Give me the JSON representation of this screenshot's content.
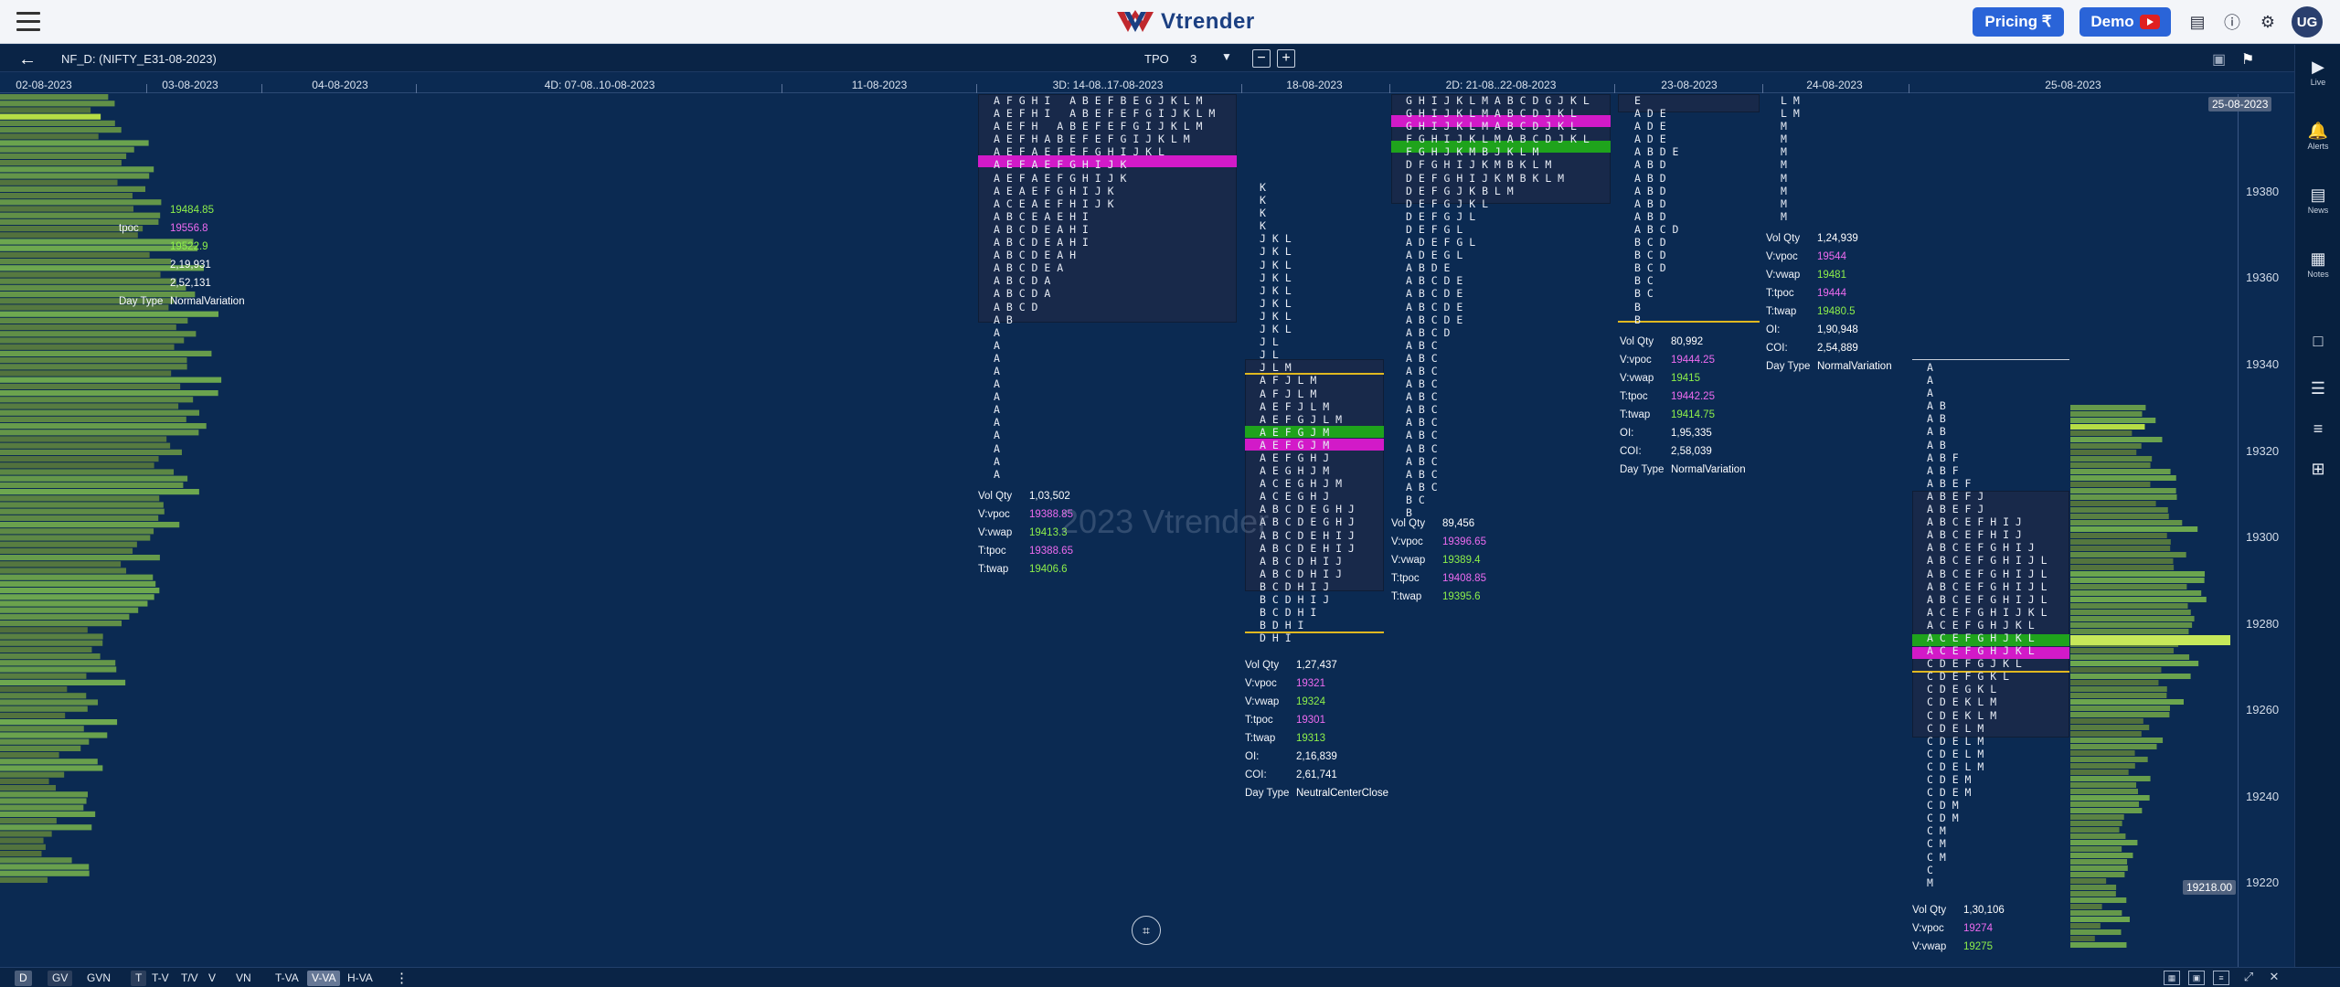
{
  "header": {
    "brand": "Vtrender",
    "pricing_label": "Pricing ₹",
    "demo_label": "Demo",
    "avatar_initials": "UG"
  },
  "toolbar": {
    "symbol": "NF_D: (NIFTY_E31-08-2023)",
    "tpo_label": "TPO",
    "tpo_value": "3",
    "dropdown_glyph": "▼",
    "minus": "−",
    "plus": "+"
  },
  "dates": [
    "02-08-2023",
    "03-08-2023",
    "04-08-2023",
    "4D: 07-08..10-08-2023",
    "11-08-2023",
    "3D: 14-08..17-08-2023",
    "18-08-2023",
    "2D: 21-08..22-08-2023",
    "23-08-2023",
    "24-08-2023",
    "25-08-2023"
  ],
  "price_axis": [
    "19380",
    "19360",
    "19340",
    "19320",
    "19300",
    "19280",
    "19260",
    "19240",
    "19220"
  ],
  "price_tags": {
    "top": "25-08-2023",
    "current": "19218.00"
  },
  "watermark": "2023 Vtrender",
  "profiles": [
    {
      "id": "d0308",
      "stats": [
        {
          "k": "",
          "v": "19484.85",
          "c": "green"
        },
        {
          "k": "tpoc",
          "v": "19556.8",
          "c": "pink"
        },
        {
          "k": "",
          "v": "19522.9",
          "c": "green"
        },
        {
          "k": "",
          "v": "2,19,931",
          "c": "white"
        },
        {
          "k": "",
          "v": "2,52,131",
          "c": "white"
        },
        {
          "k": "Day Type",
          "v": "NormalVariation",
          "c": "white"
        }
      ]
    },
    {
      "id": "d3d1417",
      "letters": [
        "AFGHI ABEFBEGJKLM",
        "AEFHI ABEFEFGIJKLM",
        "AEFH ABEFEFGIJKLM",
        "AEFHABEFEFGIJKLM",
        "AEFAEFEFGHIJKL",
        "AEFAEFGHIJK",
        "AEFAEFGHIJK",
        "AEAEFGHIJK",
        "ACEAEFHIJK",
        "ABCEAEHI",
        "ABCDEAHI",
        "ABCDEAHI",
        "ABCDEAH",
        "ABCDEA",
        "ABCDA",
        "ABCDA",
        "ABCD",
        "AB",
        "A",
        "A",
        "A",
        "A",
        "A",
        "A",
        "A",
        "A",
        "A",
        "A",
        "A",
        "A"
      ],
      "stats": [
        {
          "k": "Vol Qty",
          "v": "1,03,502",
          "c": "white"
        },
        {
          "k": "V:vpoc",
          "v": "19388.85",
          "c": "pink"
        },
        {
          "k": "V:vwap",
          "v": "19413.3",
          "c": "green"
        },
        {
          "k": "T:tpoc",
          "v": "19388.65",
          "c": "pink"
        },
        {
          "k": "T:twap",
          "v": "19406.6",
          "c": "green"
        }
      ]
    },
    {
      "id": "d1808",
      "letters": [
        "K",
        "K",
        "K",
        "K",
        "JKL",
        "JKL",
        "JKL",
        "JKL",
        "JKL",
        "JKL",
        "JKL",
        "JKL",
        "JL",
        "JL",
        "JLM",
        "AFJLM",
        "AFJLM",
        "AEFJLM",
        "AEFGJLM",
        "AEFGJM",
        "AEFGJM",
        "AEFGHJ",
        "AEGHJM",
        "ACEGHJM",
        "ACEGHJ",
        "ABCDEGHJ",
        "ABCDEGHJ",
        "ABCDEHIJ",
        "ABCDEHIJ",
        "ABCDHIJ",
        "ABCDHIJ",
        "BCDHIJ",
        "BCDHIJ",
        "BCDHI",
        "BDHI",
        "DHI"
      ],
      "stats": [
        {
          "k": "Vol Qty",
          "v": "1,27,437",
          "c": "white"
        },
        {
          "k": "V:vpoc",
          "v": "19321",
          "c": "pink"
        },
        {
          "k": "V:vwap",
          "v": "19324",
          "c": "green"
        },
        {
          "k": "T:tpoc",
          "v": "19301",
          "c": "pink"
        },
        {
          "k": "T:twap",
          "v": "19313",
          "c": "green"
        },
        {
          "k": "OI:",
          "v": "2,16,839",
          "c": "white"
        },
        {
          "k": "COI:",
          "v": "2,61,741",
          "c": "white"
        },
        {
          "k": "Day Type",
          "v": "NeutralCenterClose",
          "c": "white"
        }
      ]
    },
    {
      "id": "d2d2122",
      "letters": [
        "GHIJKLMABCDGJKL",
        "GHIJKLMABCDJKL",
        "GHIJKLMABCDJKL",
        "FGHIJKLMABCDJKL",
        "FGHJKMBJKLM",
        "DFGHIJKMBKLM",
        "DEFGHIJKMBKLM",
        "DEFGJKBLM",
        "DEFGJKL",
        "DEFGJL",
        "DEFGL",
        "ADEFGL",
        "ADEGL",
        "ABDE",
        "ABCDE",
        "ABCDE",
        "ABCDE",
        "ABCDE",
        "ABCD",
        "ABC",
        "ABC",
        "ABC",
        "ABC",
        "ABC",
        "ABC",
        "ABC",
        "ABC",
        "ABC",
        "ABC",
        "ABC",
        "ABC",
        "BC",
        "B"
      ],
      "stats": [
        {
          "k": "Vol Qty",
          "v": "89,456",
          "c": "white"
        },
        {
          "k": "V:vpoc",
          "v": "19396.65",
          "c": "pink"
        },
        {
          "k": "V:vwap",
          "v": "19389.4",
          "c": "green"
        },
        {
          "k": "T:tpoc",
          "v": "19408.85",
          "c": "pink"
        },
        {
          "k": "T:twap",
          "v": "19395.6",
          "c": "green"
        }
      ]
    },
    {
      "id": "d2308",
      "letters": [
        "E",
        "ADE",
        "ADE",
        "ADE",
        "ABDE",
        "ABD",
        "ABD",
        "ABD",
        "ABD",
        "ABD",
        "ABCD",
        "BCD",
        "BCD",
        "BCD",
        "BC",
        "BC",
        "B",
        "B"
      ],
      "stats": [
        {
          "k": "Vol Qty",
          "v": "80,992",
          "c": "white"
        },
        {
          "k": "V:vpoc",
          "v": "19444.25",
          "c": "pink"
        },
        {
          "k": "V:vwap",
          "v": "19415",
          "c": "green"
        },
        {
          "k": "T:tpoc",
          "v": "19442.25",
          "c": "pink"
        },
        {
          "k": "T:twap",
          "v": "19414.75",
          "c": "green"
        },
        {
          "k": "OI:",
          "v": "1,95,335",
          "c": "white"
        },
        {
          "k": "COI:",
          "v": "2,58,039",
          "c": "white"
        },
        {
          "k": "Day Type",
          "v": "NormalVariation",
          "c": "white"
        }
      ]
    },
    {
      "id": "d2408",
      "letters": [
        "LM",
        "LM",
        "M",
        "M",
        "M",
        "M",
        "M",
        "M",
        "M",
        "M"
      ],
      "stats": [
        {
          "k": "Vol Qty",
          "v": "1,24,939",
          "c": "white"
        },
        {
          "k": "V:vpoc",
          "v": "19544",
          "c": "pink"
        },
        {
          "k": "V:vwap",
          "v": "19481",
          "c": "green"
        },
        {
          "k": "T:tpoc",
          "v": "19444",
          "c": "pink"
        },
        {
          "k": "T:twap",
          "v": "19480.5",
          "c": "green"
        },
        {
          "k": "OI:",
          "v": "1,90,948",
          "c": "white"
        },
        {
          "k": "COI:",
          "v": "2,54,889",
          "c": "white"
        },
        {
          "k": "Day Type",
          "v": "NormalVariation",
          "c": "white"
        }
      ]
    },
    {
      "id": "d2508",
      "letters": [
        "A",
        "A",
        "A",
        "AB",
        "AB",
        "AB",
        "AB",
        "ABF",
        "ABF",
        "ABEF",
        "ABEFJ",
        "ABEFJ",
        "ABCEFHIJ",
        "ABCEFHIJ",
        "ABCEFGHIJ",
        "ABCEFGHIJL",
        "ABCEFGHIJL",
        "ABCEFGHIJL",
        "ABCEFGHIJL",
        "ACEFGHIJKL",
        "ACEFGHJKL",
        "ACEFGHJKL",
        "ACEFGHJKL",
        "CDEFGJKL",
        "CDEFGKL",
        "CDEGKL",
        "CDEKLM",
        "CDEKLM",
        "CDELM",
        "CDELM",
        "CDELM",
        "CDELM",
        "CDEM",
        "CDEM",
        "CDM",
        "CDM",
        "CM",
        "CM",
        "CM",
        "C",
        "M"
      ],
      "stats": [
        {
          "k": "Vol Qty",
          "v": "1,30,106",
          "c": "white"
        },
        {
          "k": "V:vpoc",
          "v": "19274",
          "c": "pink"
        },
        {
          "k": "V:vwap",
          "v": "19275",
          "c": "green"
        }
      ]
    }
  ],
  "bottombar": {
    "buttons": [
      "D",
      "GV",
      "GVN",
      "T",
      "T-V",
      "T/V",
      "V",
      "VN",
      "T-VA",
      "V-VA",
      "H-VA"
    ],
    "more": "⋮"
  },
  "right_panel": [
    {
      "icon": "▶",
      "label": "Live"
    },
    {
      "icon": "🔔",
      "label": "Alerts"
    },
    {
      "icon": "▤",
      "label": "News"
    },
    {
      "icon": "▦",
      "label": "Notes"
    },
    {
      "icon": "□",
      "label": ""
    },
    {
      "icon": "☰",
      "label": ""
    },
    {
      "icon": "≡",
      "label": ""
    },
    {
      "icon": "⊞",
      "label": ""
    }
  ]
}
